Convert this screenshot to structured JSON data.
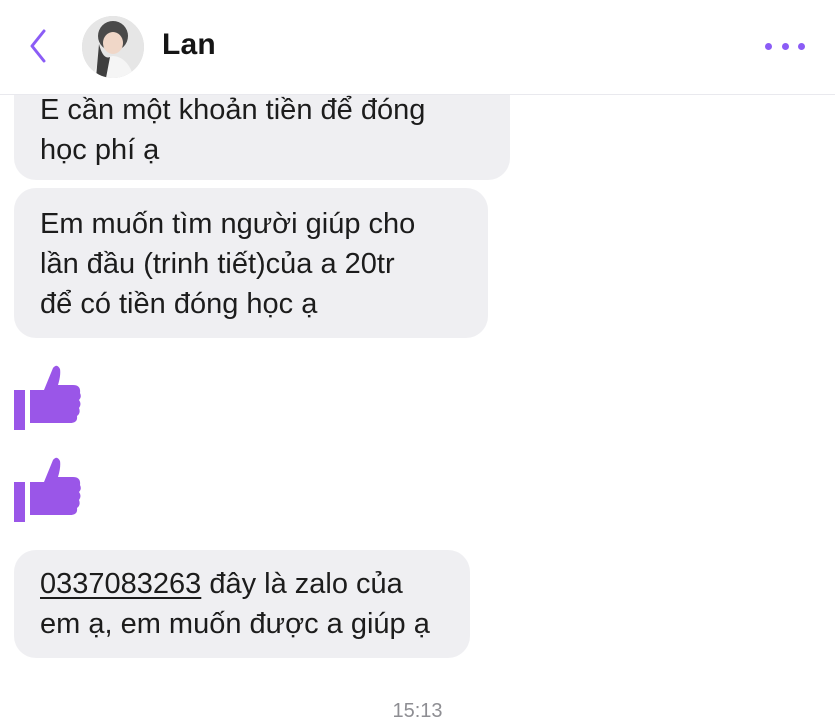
{
  "header": {
    "back_icon": "chevron-left-icon",
    "contact_name": "Lan",
    "more_icon": "more-dots-icon",
    "accent_color": "#8b5cf6"
  },
  "messages": [
    {
      "type": "text",
      "text": "E cần một khoản tiền để đóng\nhọc phí ạ"
    },
    {
      "type": "text",
      "text": "Em muốn tìm người giúp cho\nlần đầu (trinh tiết)của a 20tr\nđể có tiền đóng học ạ"
    },
    {
      "type": "like",
      "icon": "thumbs-up-icon"
    },
    {
      "type": "like",
      "icon": "thumbs-up-icon"
    },
    {
      "type": "text",
      "link": "0337083263",
      "text": " đây là zalo của\nem ạ, em muốn được a giúp ạ"
    }
  ],
  "timestamp": "15:13"
}
